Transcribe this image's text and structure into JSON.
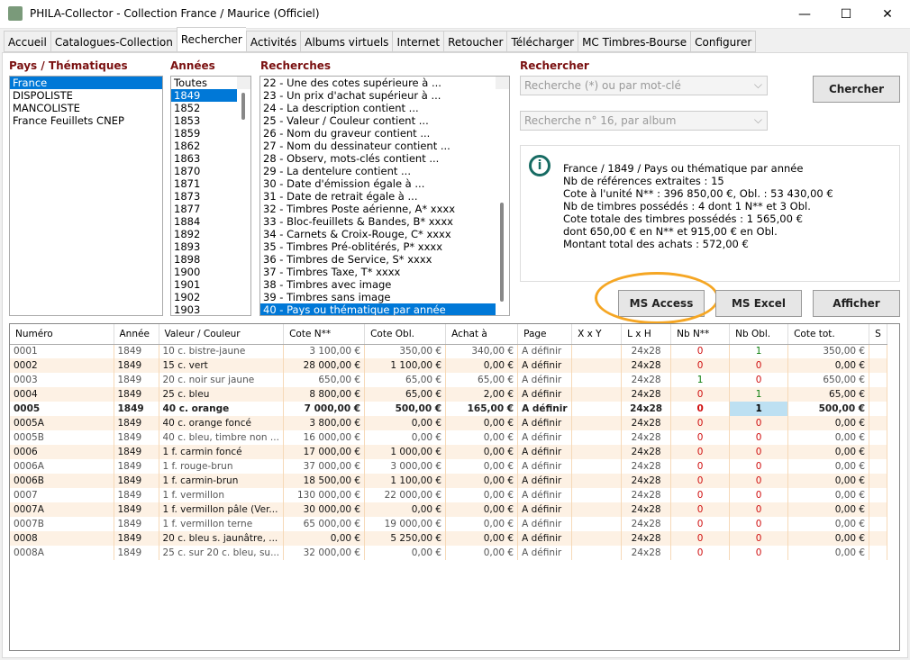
{
  "window": {
    "title": "PHILA-Collector - Collection France / Maurice (Officiel)",
    "minimize": "—",
    "maximize": "☐",
    "close": "✕"
  },
  "tabs": [
    "Accueil",
    "Catalogues-Collection",
    "Rechercher",
    "Activités",
    "Albums virtuels",
    "Internet",
    "Retoucher",
    "Télécharger",
    "MC Timbres-Bourse",
    "Configurer"
  ],
  "active_tab": "Rechercher",
  "pays": {
    "label": "Pays / Thématiques",
    "items": [
      "France",
      "DISPOLISTE",
      "MANCOLISTE",
      "France Feuillets CNEP"
    ],
    "selected": "France"
  },
  "annees": {
    "label": "Années",
    "items": [
      "Toutes",
      "1849",
      "1852",
      "1853",
      "1859",
      "1862",
      "1863",
      "1870",
      "1871",
      "1873",
      "1877",
      "1884",
      "1892",
      "1893",
      "1898",
      "1900",
      "1901",
      "1902",
      "1903"
    ],
    "selected": "1849"
  },
  "recherches": {
    "label": "Recherches",
    "items": [
      "22 - Une des cotes supérieure à ...",
      "23 - Un prix d'achat supérieur à ...",
      "24 - La description contient ...",
      "25 - Valeur / Couleur contient ...",
      "26 - Nom du graveur contient ...",
      "27 - Nom du dessinateur contient ...",
      "28 - Observ, mots-clés contient ...",
      "29 - La dentelure contient ...",
      "30 - Date d'émission égale à ...",
      "31 - Date de retrait égale à ...",
      "32 - Timbres Poste aérienne, A* xxxx",
      "33 - Bloc-feuillets & Bandes, B* xxxx",
      "34 - Carnets & Croix-Rouge, C* xxxx",
      "35 - Timbres Pré-oblitérés, P* xxxx",
      "36 - Timbres de Service, S* xxxx",
      "37 - Timbres Taxe, T* xxxx",
      "38 - Timbres avec image",
      "39 - Timbres sans image",
      "40 - Pays ou thématique par année"
    ],
    "selected": "40 - Pays ou thématique par année"
  },
  "rechercher": {
    "label": "Rechercher",
    "combo1": "Recherche (*) ou par mot-clé",
    "combo2": "Recherche n° 16, par album",
    "chercher": "Chercher"
  },
  "info": {
    "icon": "info-icon",
    "lines": [
      "France / 1849 / Pays ou thématique par année",
      "Nb de références extraites : 15",
      "Cote à l'unité N** : 396 850,00 €, Obl. : 53 430,00 €",
      "Nb de timbres possédés : 4 dont 1 N** et 3 Obl.",
      "Cote totale des timbres possédés : 1 565,00 €",
      "dont 650,00 € en N** et 915,00 € en Obl.",
      "Montant total des achats : 572,00 €"
    ]
  },
  "buttons": {
    "access": "MS Access",
    "excel": "MS Excel",
    "afficher": "Afficher"
  },
  "highlight_color": "#f5a623",
  "table": {
    "columns": [
      "Numéro",
      "Année",
      "Valeur / Couleur",
      "Cote N**",
      "Cote Obl.",
      "Achat à",
      "Page",
      "X x Y",
      "L x H",
      "Nb N**",
      "Nb Obl.",
      "Cote tot.",
      "S"
    ],
    "rows": [
      [
        "0001",
        "1849",
        "10 c. bistre-jaune",
        "3 100,00 €",
        "350,00 €",
        "340,00 €",
        "A définir",
        "",
        "24x28",
        "0",
        "1",
        "350,00 €",
        ""
      ],
      [
        "0002",
        "1849",
        "15 c. vert",
        "28 000,00 €",
        "1 100,00 €",
        "0,00 €",
        "A définir",
        "",
        "24x28",
        "0",
        "0",
        "0,00 €",
        ""
      ],
      [
        "0003",
        "1849",
        "20 c. noir sur jaune",
        "650,00 €",
        "65,00 €",
        "65,00 €",
        "A définir",
        "",
        "24x28",
        "1",
        "0",
        "650,00 €",
        ""
      ],
      [
        "0004",
        "1849",
        "25 c. bleu",
        "8 800,00 €",
        "65,00 €",
        "2,00 €",
        "A définir",
        "",
        "24x28",
        "0",
        "1",
        "65,00 €",
        ""
      ],
      [
        "0005",
        "1849",
        "40 c. orange",
        "7 000,00 €",
        "500,00 €",
        "165,00 €",
        "A définir",
        "",
        "24x28",
        "0",
        "1",
        "500,00 €",
        ""
      ],
      [
        "0005A",
        "1849",
        "40 c. orange foncé",
        "3 800,00 €",
        "0,00 €",
        "0,00 €",
        "A définir",
        "",
        "24x28",
        "0",
        "0",
        "0,00 €",
        ""
      ],
      [
        "0005B",
        "1849",
        "40 c. bleu, timbre non ...",
        "16 000,00 €",
        "0,00 €",
        "0,00 €",
        "A définir",
        "",
        "24x28",
        "0",
        "0",
        "0,00 €",
        ""
      ],
      [
        "0006",
        "1849",
        "1 f. carmin foncé",
        "17 000,00 €",
        "1 000,00 €",
        "0,00 €",
        "A définir",
        "",
        "24x28",
        "0",
        "0",
        "0,00 €",
        ""
      ],
      [
        "0006A",
        "1849",
        "1 f. rouge-brun",
        "37 000,00 €",
        "3 000,00 €",
        "0,00 €",
        "A définir",
        "",
        "24x28",
        "0",
        "0",
        "0,00 €",
        ""
      ],
      [
        "0006B",
        "1849",
        "1 f. carmin-brun",
        "18 500,00 €",
        "1 100,00 €",
        "0,00 €",
        "A définir",
        "",
        "24x28",
        "0",
        "0",
        "0,00 €",
        ""
      ],
      [
        "0007",
        "1849",
        "1 f. vermillon",
        "130 000,00 €",
        "22 000,00 €",
        "0,00 €",
        "A définir",
        "",
        "24x28",
        "0",
        "0",
        "0,00 €",
        ""
      ],
      [
        "0007A",
        "1849",
        "1 f. vermillon pâle (Ver...",
        "30 000,00 €",
        "0,00 €",
        "0,00 €",
        "A définir",
        "",
        "24x28",
        "0",
        "0",
        "0,00 €",
        ""
      ],
      [
        "0007B",
        "1849",
        "1 f. vermillon terne",
        "65 000,00 €",
        "19 000,00 €",
        "0,00 €",
        "A définir",
        "",
        "24x28",
        "0",
        "0",
        "0,00 €",
        ""
      ],
      [
        "0008",
        "1849",
        "20 c. bleu s. jaunâtre, ...",
        "0,00 €",
        "5 250,00 €",
        "0,00 €",
        "A définir",
        "",
        "24x28",
        "0",
        "0",
        "0,00 €",
        ""
      ],
      [
        "0008A",
        "1849",
        "25 c. sur 20 c. bleu, su...",
        "32 000,00 €",
        "0,00 €",
        "0,00 €",
        "A définir",
        "",
        "24x28",
        "0",
        "0",
        "0,00 €",
        ""
      ]
    ],
    "selected_row": "0005"
  }
}
